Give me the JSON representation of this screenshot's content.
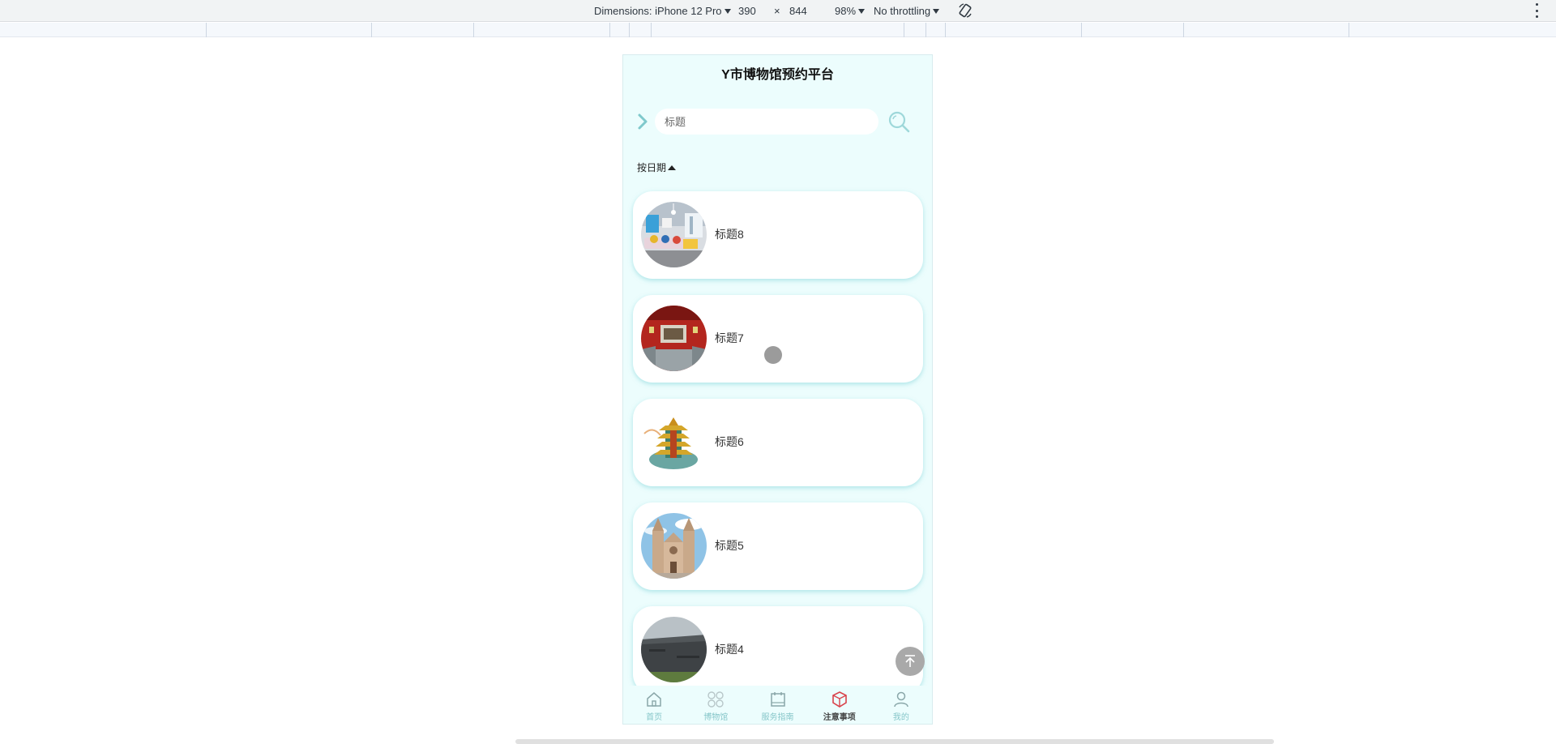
{
  "devtools": {
    "dimensions_label": "Dimensions: iPhone 12 Pro",
    "width": "390",
    "times": "×",
    "height": "844",
    "zoom": "98%",
    "throttling": "No throttling",
    "rotate_icon": "rotate-icon",
    "more_icon": "more-vertical-icon"
  },
  "app": {
    "title": "Y市博物馆预约平台",
    "search": {
      "placeholder": "标题",
      "search_icon": "search-icon",
      "expand_icon": "chevron-right-icon"
    },
    "sort_label": "按日期",
    "items": [
      {
        "label": "标题8",
        "image": "living-room-photo"
      },
      {
        "label": "标题7",
        "image": "red-gallery-photo"
      },
      {
        "label": "标题6",
        "image": "pagoda-tower-photo"
      },
      {
        "label": "标题5",
        "image": "church-photo"
      },
      {
        "label": "标题4",
        "image": "modern-museum-building-photo"
      }
    ],
    "back_to_top_icon": "arrow-up-to-top-icon",
    "tabbar": [
      {
        "label": "首页",
        "icon": "home-icon",
        "active": false
      },
      {
        "label": "博物馆",
        "icon": "grid-icon",
        "active": false
      },
      {
        "label": "服务指南",
        "icon": "calendar-icon",
        "active": false
      },
      {
        "label": "注意事项",
        "icon": "cube-icon",
        "active": true
      },
      {
        "label": "我的",
        "icon": "user-icon",
        "active": false
      }
    ]
  },
  "colors": {
    "page_bg": "#ecfdfd",
    "accent": "#7fc9cc",
    "active_icon": "#d9434b"
  }
}
